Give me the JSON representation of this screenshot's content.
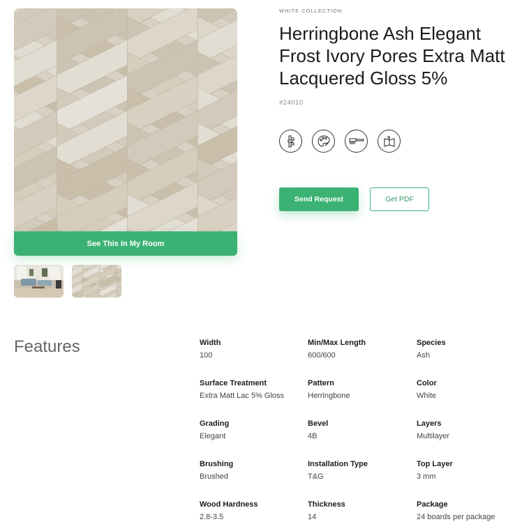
{
  "product": {
    "collection": "WHITE COLLECTION",
    "title": "Herringbone Ash Elegant Frost Ivory Pores Extra Matt Lacquered Gloss 5%",
    "sku": "#24010"
  },
  "gallery": {
    "room_button_label": "See This In My Room",
    "thumbnails": [
      "room-scene",
      "herringbone-texture"
    ]
  },
  "icons": [
    "herringbone-pattern-icon",
    "palette-icon",
    "brush-icon",
    "installation-guide-icon"
  ],
  "actions": {
    "send_request": "Send Request",
    "get_pdf": "Get PDF"
  },
  "features": {
    "heading": "Features",
    "items": [
      {
        "label": "Width",
        "value": "100"
      },
      {
        "label": "Min/Max Length",
        "value": "600/600"
      },
      {
        "label": "Species",
        "value": "Ash"
      },
      {
        "label": "Surface Treatment",
        "value": "Extra Matt Lac 5% Gloss"
      },
      {
        "label": "Pattern",
        "value": "Herringbone"
      },
      {
        "label": "Color",
        "value": "White"
      },
      {
        "label": "Grading",
        "value": "Elegant"
      },
      {
        "label": "Bevel",
        "value": "4B"
      },
      {
        "label": "Layers",
        "value": "Multilayer"
      },
      {
        "label": "Brushing",
        "value": "Brushed"
      },
      {
        "label": "Installation Type",
        "value": "T&G"
      },
      {
        "label": "Top Layer",
        "value": "3 mm"
      },
      {
        "label": "Wood Hardness",
        "value": "2.8-3.5"
      },
      {
        "label": "Thickness",
        "value": "14"
      },
      {
        "label": "Package",
        "value": "24 boards per package"
      }
    ]
  },
  "colors": {
    "accent": "#3bb273",
    "wood_light": "#ddd6c9",
    "wood_mid": "#cfc6b6"
  }
}
